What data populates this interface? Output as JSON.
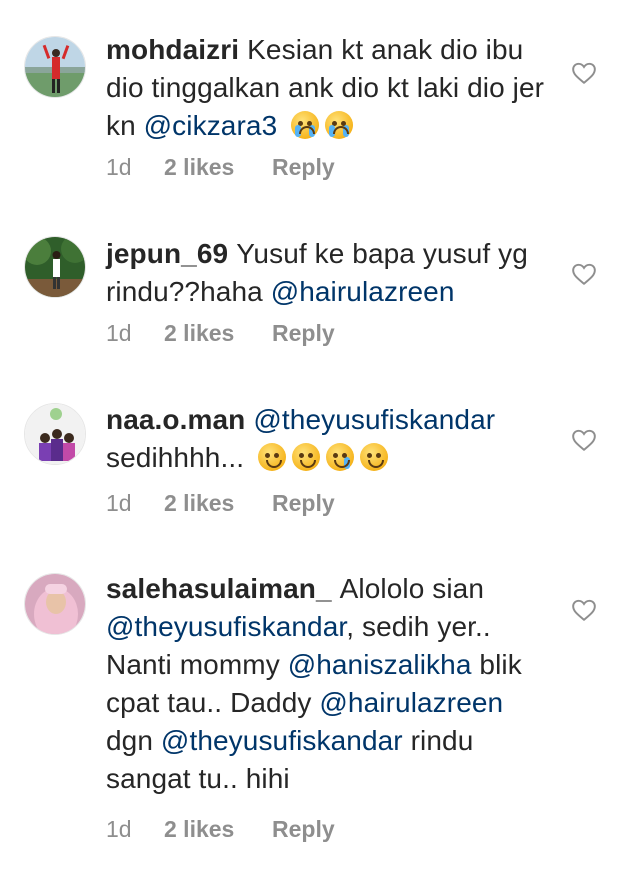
{
  "comments": [
    {
      "username": "mohdaizri",
      "text": "Kesian kt anak dio ibu dio tinggalkan ank dio kt laki dio jer kn ",
      "mention": "@cikzara3",
      "after": "",
      "emojis": [
        "crying-face",
        "crying-face"
      ],
      "time": "1d",
      "likes": "2 likes",
      "reply": "Reply"
    },
    {
      "username": "jepun_69",
      "text": "Yusuf ke bapa yusuf yg rindu??haha ",
      "mention": "@hairulazreen",
      "after": "",
      "emojis": [],
      "time": "1d",
      "likes": "2 likes",
      "reply": "Reply"
    },
    {
      "username": "naa.o.man",
      "mention": "@theyusufiskandar",
      "text2": "sedihhhh...",
      "emojis": [
        "sad-face",
        "sad-face",
        "sad-tear-face",
        "sad-face"
      ],
      "time": "1d",
      "likes": "2 likes",
      "reply": "Reply"
    },
    {
      "username": "salehasulaiman_",
      "t1": "Alololo sian",
      "m1": "@theyusufiskandar",
      "t2": ", sedih yer.. Nanti mommy",
      "m2": "@haniszalikha",
      "t3": "blik cpat tau.. Daddy",
      "m3": "@hairulazreen",
      "t4": "dgn",
      "m4": "@theyusufiskandar",
      "t5": "rindu sangat tu.. hihi",
      "time": "1d",
      "likes": "2 likes",
      "reply": "Reply"
    }
  ],
  "icons": {
    "like": "heart-outline-icon"
  },
  "colors": {
    "mention": "#003569",
    "meta": "#8e8e8e",
    "text": "#262626"
  }
}
